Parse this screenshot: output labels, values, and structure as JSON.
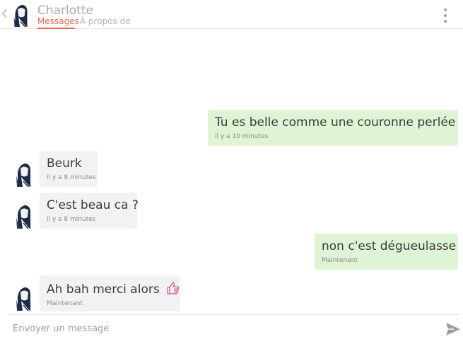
{
  "header": {
    "contact_name": "Charlotte",
    "tab_messages": "Messages",
    "tab_about": "À propos de"
  },
  "messages": [
    {
      "direction": "outgoing",
      "text": "Tu es belle comme une couronne perlée",
      "time": "il y a 10 minutes"
    },
    {
      "direction": "incoming",
      "text": "Beurk",
      "time": "il y a 8 minutes"
    },
    {
      "direction": "incoming",
      "text": "C'est beau ca ?",
      "time": "il y a 8 minutes"
    },
    {
      "direction": "outgoing",
      "text": "non c'est dégueulasse",
      "time": "Maintenant"
    },
    {
      "direction": "incoming",
      "text": "Ah bah merci alors",
      "time": "Maintenant",
      "icon": "thumbs-up-icon"
    }
  ],
  "composer": {
    "placeholder": "Envoyer un message"
  },
  "colors": {
    "accent": "#e8664c",
    "outgoing_bubble": "#dff3d5",
    "incoming_bubble": "#f2f2f2"
  }
}
